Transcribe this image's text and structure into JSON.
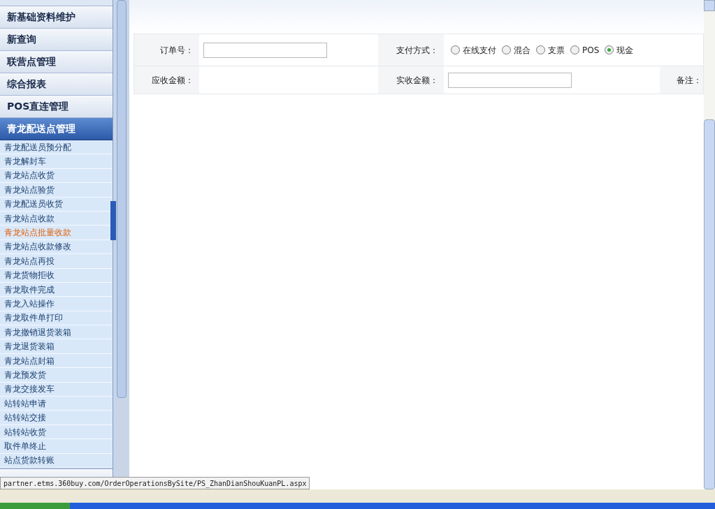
{
  "sidebar": {
    "sections": [
      {
        "label": "新基础资料维护",
        "expanded": false
      },
      {
        "label": "新查询",
        "expanded": false
      },
      {
        "label": "联营点管理",
        "expanded": false
      },
      {
        "label": "综合报表",
        "expanded": false
      },
      {
        "label": "POS直连管理",
        "expanded": false
      },
      {
        "label": "青龙配送点管理",
        "expanded": true,
        "items": [
          {
            "label": "青龙配送员预分配",
            "selected": false
          },
          {
            "label": "青龙解封车",
            "selected": false
          },
          {
            "label": "青龙站点收货",
            "selected": false
          },
          {
            "label": "青龙站点验货",
            "selected": false
          },
          {
            "label": "青龙配送员收货",
            "selected": false
          },
          {
            "label": "青龙站点收款",
            "selected": false
          },
          {
            "label": "青龙站点批量收款",
            "selected": true
          },
          {
            "label": "青龙站点收款修改",
            "selected": false
          },
          {
            "label": "青龙站点再投",
            "selected": false
          },
          {
            "label": "青龙货物拒收",
            "selected": false
          },
          {
            "label": "青龙取件完成",
            "selected": false
          },
          {
            "label": "青龙入站操作",
            "selected": false
          },
          {
            "label": "青龙取件单打印",
            "selected": false
          },
          {
            "label": "青龙撤销退货装箱",
            "selected": false
          },
          {
            "label": "青龙退货装箱",
            "selected": false
          },
          {
            "label": "青龙站点封箱",
            "selected": false
          },
          {
            "label": "青龙预发货",
            "selected": false
          },
          {
            "label": "青龙交接发车",
            "selected": false
          },
          {
            "label": "站转站申请",
            "selected": false
          },
          {
            "label": "站转站交接",
            "selected": false
          },
          {
            "label": "站转站收货",
            "selected": false
          },
          {
            "label": "取件单终止",
            "selected": false
          },
          {
            "label": "站点货款转账",
            "selected": false
          }
        ]
      }
    ]
  },
  "form": {
    "order_no_label": "订单号：",
    "payment_label": "支付方式：",
    "payment_options": [
      {
        "label": "在线支付",
        "selected": false
      },
      {
        "label": "混合",
        "selected": false
      },
      {
        "label": "支票",
        "selected": false
      },
      {
        "label": "POS",
        "selected": false
      },
      {
        "label": "现金",
        "selected": true
      }
    ],
    "receivable_label": "应收金额：",
    "received_label": "实收金额：",
    "remark_label": "备注："
  },
  "status_url": "partner.etms.360buy.com/OrderOperationsBySite/PS_ZhanDianShouKuanPL.aspx"
}
